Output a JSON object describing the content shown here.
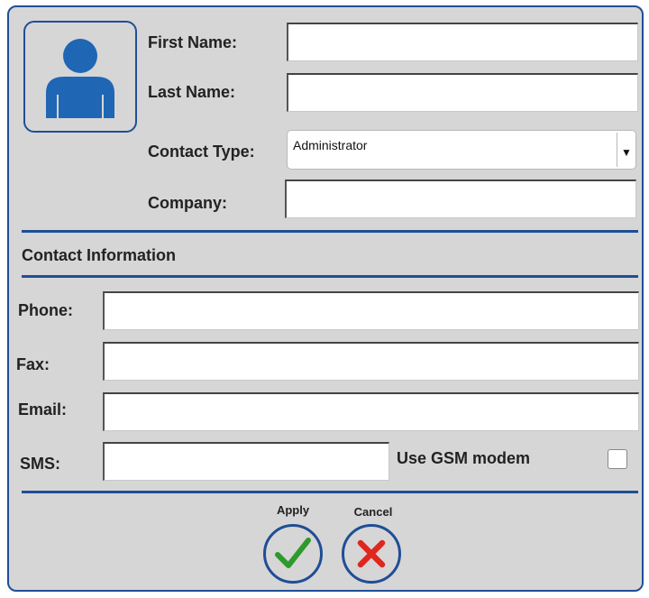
{
  "form": {
    "first_name_label": "First Name:",
    "last_name_label": "Last Name:",
    "contact_type_label": "Contact Type:",
    "contact_type_value": "Administrator",
    "company_label": "Company:",
    "first_name_value": "",
    "last_name_value": "",
    "company_value": ""
  },
  "contact": {
    "section_title": "Contact Information",
    "phone_label": "Phone:",
    "fax_label": "Fax:",
    "email_label": "Email:",
    "sms_label": "SMS:",
    "gsm_label": "Use GSM modem",
    "gsm_checked": false,
    "phone_value": "",
    "fax_value": "",
    "email_value": "",
    "sms_value": ""
  },
  "actions": {
    "apply_label": "Apply",
    "cancel_label": "Cancel"
  },
  "icons": {
    "avatar": "person-icon",
    "apply": "checkmark-icon",
    "cancel": "x-icon",
    "dropdown": "chevron-down-icon"
  },
  "colors": {
    "accent": "#1f4e96",
    "avatar": "#1f66b5",
    "apply": "#2e9a2e",
    "cancel": "#e0261e",
    "background": "#d6d6d6"
  }
}
